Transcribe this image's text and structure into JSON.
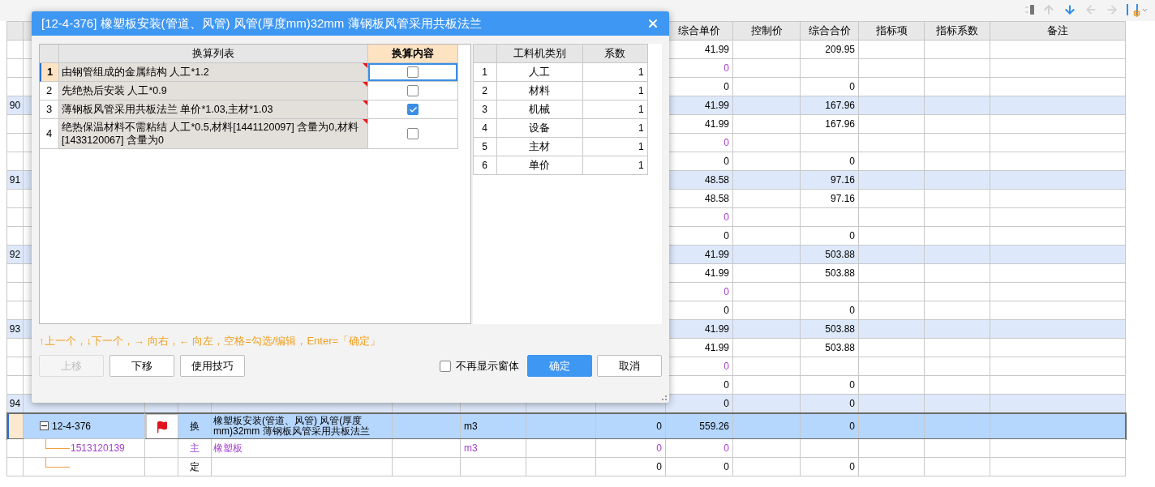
{
  "table": {
    "columns": [
      "综合单价",
      "控制价",
      "综合合价",
      "指标项",
      "指标系数",
      "备注"
    ],
    "rows": [
      {
        "kind": "sub",
        "selected": false,
        "unit_price": "41.99",
        "total": "209.95"
      },
      {
        "kind": "material",
        "selected": false,
        "unit_price": "0"
      },
      {
        "kind": "other",
        "selected": false,
        "unit_price": "0",
        "total": "0"
      },
      {
        "kind": "item",
        "selected": false,
        "row_number": "90",
        "unit_price": "41.99",
        "total": "167.96"
      },
      {
        "kind": "sub",
        "selected": false,
        "unit_price": "41.99",
        "total": "167.96"
      },
      {
        "kind": "material",
        "selected": false,
        "unit_price": "0"
      },
      {
        "kind": "other",
        "selected": false,
        "unit_price": "0",
        "total": "0"
      },
      {
        "kind": "item",
        "selected": false,
        "row_number": "91",
        "unit_price": "48.58",
        "total": "97.16"
      },
      {
        "kind": "sub",
        "selected": false,
        "unit_price": "48.58",
        "total": "97.16"
      },
      {
        "kind": "material",
        "selected": false,
        "unit_price": "0"
      },
      {
        "kind": "other",
        "selected": false,
        "unit_price": "0",
        "total": "0"
      },
      {
        "kind": "item",
        "selected": false,
        "row_number": "92",
        "unit_price": "41.99",
        "total": "503.88"
      },
      {
        "kind": "sub",
        "selected": false,
        "unit_price": "41.99",
        "total": "503.88"
      },
      {
        "kind": "material",
        "selected": false,
        "unit_price": "0"
      },
      {
        "kind": "other",
        "selected": false,
        "unit_price": "0",
        "total": "0"
      },
      {
        "kind": "item",
        "selected": false,
        "row_number": "93",
        "unit_price": "41.99",
        "total": "503.88"
      },
      {
        "kind": "sub",
        "selected": false,
        "unit_price": "41.99",
        "total": "503.88"
      },
      {
        "kind": "material",
        "selected": false,
        "unit_price": "0"
      },
      {
        "kind": "other",
        "selected": false,
        "unit_price": "0",
        "total": "0"
      },
      {
        "kind": "item",
        "selected": false,
        "row_number": "94",
        "unit_price": "0",
        "total": "0"
      },
      {
        "kind": "sub",
        "selected": true,
        "expanded": true,
        "flagged": true,
        "column_1": "12-4-376",
        "column_3": "换",
        "column_4": "橡塑板安装(管道、风管) 风管(厚度mm)32mm  薄钢板风管采用共板法兰",
        "column_6": "m3",
        "column_8": "0",
        "unit_price": "559.26",
        "total": "0",
        "children": [
          {
            "kind": "material",
            "selected": false,
            "column_1": "1513120139",
            "column_3": "主",
            "column_4": "橡塑板",
            "column_6": "m3",
            "column_8": "0",
            "unit_price": "0"
          },
          {
            "kind": "other",
            "selected": false,
            "column_3": "定",
            "column_8": "0",
            "unit_price": "0",
            "total": "0"
          }
        ]
      }
    ]
  },
  "dialog": {
    "title": "[12-4-376] 橡塑板安装(管道、风管) 风管(厚度mm)32mm  薄钢板风管采用共板法兰",
    "conversion_table": {
      "columns": [
        "换算列表",
        "换算内容"
      ],
      "rows": [
        {
          "number": "1",
          "text": "由钢管组成的金属结构 人工*1.2",
          "checked": false,
          "selected": true
        },
        {
          "number": "2",
          "text": "先绝热后安装 人工*0.9",
          "checked": false,
          "selected": false
        },
        {
          "number": "3",
          "text": "薄钢板风管采用共板法兰 单价*1.03,主材*1.03",
          "checked": true,
          "selected": false
        },
        {
          "number": "4",
          "text": "绝热保温材料不需粘结 人工*0.5,材料[1441120097] 含量为0,材料[1433120067] 含量为0",
          "checked": false,
          "selected": false
        }
      ]
    },
    "coefficient_table": {
      "columns": [
        "工料机类别",
        "系数"
      ],
      "rows": [
        {
          "number": "1",
          "category": "人工",
          "coefficient": "1"
        },
        {
          "number": "2",
          "category": "材料",
          "coefficient": "1"
        },
        {
          "number": "3",
          "category": "机械",
          "coefficient": "1"
        },
        {
          "number": "4",
          "category": "设备",
          "coefficient": "1"
        },
        {
          "number": "5",
          "category": "主材",
          "coefficient": "1"
        },
        {
          "number": "6",
          "category": "单价",
          "coefficient": "1"
        }
      ]
    },
    "hint": "↑上一个，↓下一个，→ 向右，← 向左，空格=勾选/编辑，Enter=「确定」",
    "left_buttons": [
      {
        "label": "上移",
        "disabled": true
      },
      {
        "label": "下移",
        "disabled": false
      },
      {
        "label": "使用技巧",
        "disabled": false
      }
    ],
    "dont_show_again": {
      "label": "不再显示窗体",
      "checked": false
    },
    "right_buttons": [
      {
        "label": "确定",
        "kind": "primary"
      },
      {
        "label": "取消",
        "kind": "default"
      }
    ]
  }
}
